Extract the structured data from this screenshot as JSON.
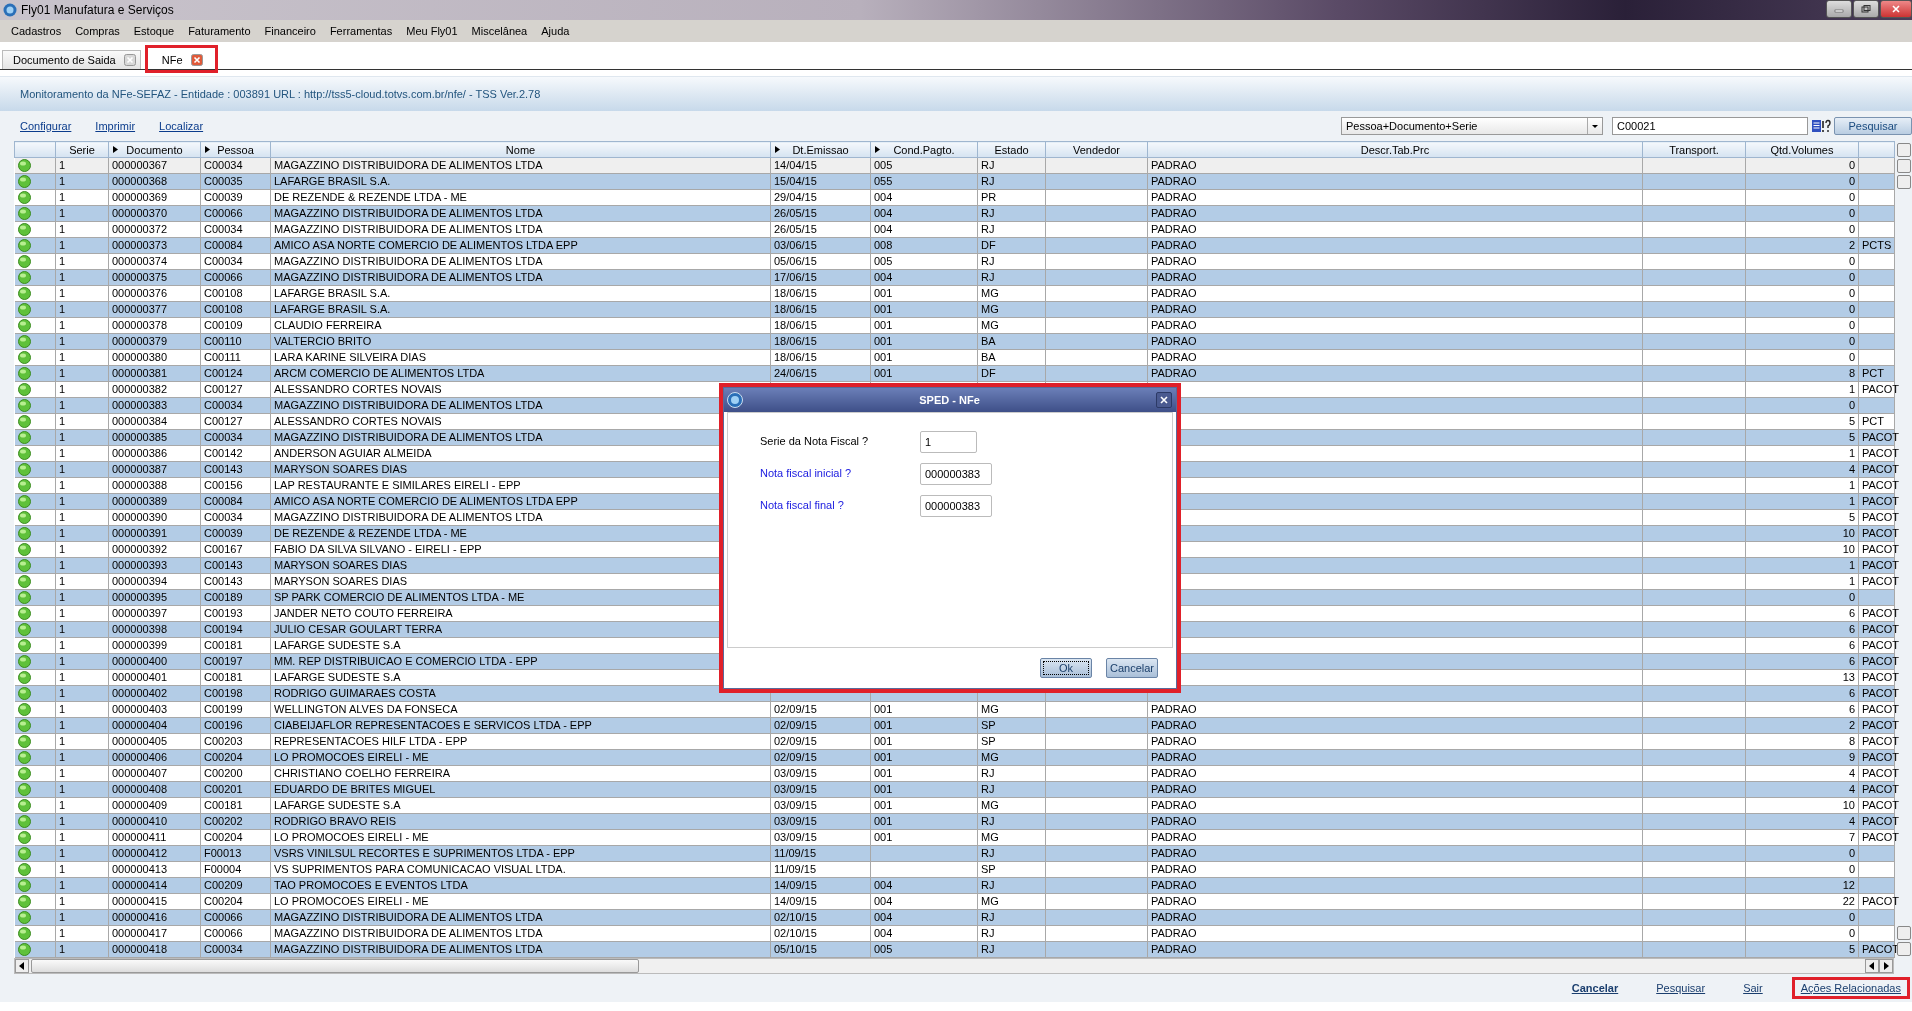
{
  "window": {
    "title": "Fly01 Manufatura e Serviços"
  },
  "menu": [
    "Cadastros",
    "Compras",
    "Estoque",
    "Faturamento",
    "Financeiro",
    "Ferramentas",
    "Meu Fly01",
    "Miscelânea",
    "Ajuda"
  ],
  "tabs": [
    {
      "label": "Documento de Saida",
      "selected": false,
      "highlighted": false
    },
    {
      "label": "NFe",
      "selected": true,
      "highlighted": true
    }
  ],
  "header": {
    "text": "Monitoramento da NFe-SEFAZ - Entidade : 003891 URL : http://tss5-cloud.totvs.com.br/nfe/ - TSS Ver.2.78"
  },
  "links": [
    "Configurar",
    "Imprimir",
    "Localizar"
  ],
  "search": {
    "index": "Pessoa+Documento+Serie",
    "value": "C00021",
    "button": "Pesquisar"
  },
  "table": {
    "columns": [
      {
        "label": "Serie",
        "sortable": false
      },
      {
        "label": "Documento",
        "sortable": true
      },
      {
        "label": "Pessoa",
        "sortable": true
      },
      {
        "label": "Nome",
        "sortable": false
      },
      {
        "label": "Dt.Emissao",
        "sortable": true
      },
      {
        "label": "Cond.Pagto.",
        "sortable": true
      },
      {
        "label": "Estado",
        "sortable": false
      },
      {
        "label": "Vendedor",
        "sortable": false
      },
      {
        "label": "Descr.Tab.Prc",
        "sortable": false
      },
      {
        "label": "Transport.",
        "sortable": false
      },
      {
        "label": "Qtd.Volumes",
        "sortable": false
      }
    ],
    "rows": [
      {
        "selected": true,
        "serie": "1",
        "documento": "000000367",
        "pessoa": "C00034",
        "nome": "MAGAZZINO DISTRIBUIDORA DE ALIMENTOS LTDA",
        "dt_emissao": "14/04/15",
        "cond_pagto": "005",
        "estado": "RJ",
        "descr_tab_prc": "PADRAO",
        "qtd_volumes": "0"
      },
      {
        "selected": false,
        "serie": "1",
        "documento": "000000368",
        "pessoa": "C00035",
        "nome": "LAFARGE BRASIL S.A.",
        "dt_emissao": "15/04/15",
        "cond_pagto": "055",
        "estado": "RJ",
        "descr_tab_prc": "PADRAO",
        "qtd_volumes": "0"
      },
      {
        "selected": false,
        "serie": "1",
        "documento": "000000369",
        "pessoa": "C00039",
        "nome": "DE REZENDE & REZENDE LTDA - ME",
        "dt_emissao": "29/04/15",
        "cond_pagto": "004",
        "estado": "PR",
        "descr_tab_prc": "PADRAO",
        "qtd_volumes": "0"
      },
      {
        "selected": false,
        "serie": "1",
        "documento": "000000370",
        "pessoa": "C00066",
        "nome": "MAGAZZINO DISTRIBUIDORA DE ALIMENTOS LTDA",
        "dt_emissao": "26/05/15",
        "cond_pagto": "004",
        "estado": "RJ",
        "descr_tab_prc": "PADRAO",
        "qtd_volumes": "0"
      },
      {
        "selected": false,
        "serie": "1",
        "documento": "000000372",
        "pessoa": "C00034",
        "nome": "MAGAZZINO DISTRIBUIDORA DE ALIMENTOS LTDA",
        "dt_emissao": "26/05/15",
        "cond_pagto": "004",
        "estado": "RJ",
        "descr_tab_prc": "PADRAO",
        "qtd_volumes": "0"
      },
      {
        "selected": false,
        "serie": "1",
        "documento": "000000373",
        "pessoa": "C00084",
        "nome": "AMICO ASA NORTE COMERCIO DE ALIMENTOS LTDA EPP",
        "dt_emissao": "03/06/15",
        "cond_pagto": "008",
        "estado": "DF",
        "descr_tab_prc": "PADRAO",
        "qtd_volumes": "2",
        "column_13": "PCTS"
      },
      {
        "selected": false,
        "serie": "1",
        "documento": "000000374",
        "pessoa": "C00034",
        "nome": "MAGAZZINO DISTRIBUIDORA DE ALIMENTOS LTDA",
        "dt_emissao": "05/06/15",
        "cond_pagto": "005",
        "estado": "RJ",
        "descr_tab_prc": "PADRAO",
        "qtd_volumes": "0"
      },
      {
        "selected": false,
        "serie": "1",
        "documento": "000000375",
        "pessoa": "C00066",
        "nome": "MAGAZZINO DISTRIBUIDORA DE ALIMENTOS LTDA",
        "dt_emissao": "17/06/15",
        "cond_pagto": "004",
        "estado": "RJ",
        "descr_tab_prc": "PADRAO",
        "qtd_volumes": "0"
      },
      {
        "selected": false,
        "serie": "1",
        "documento": "000000376",
        "pessoa": "C00108",
        "nome": "LAFARGE BRASIL S.A.",
        "dt_emissao": "18/06/15",
        "cond_pagto": "001",
        "estado": "MG",
        "descr_tab_prc": "PADRAO",
        "qtd_volumes": "0"
      },
      {
        "selected": false,
        "serie": "1",
        "documento": "000000377",
        "pessoa": "C00108",
        "nome": "LAFARGE BRASIL S.A.",
        "dt_emissao": "18/06/15",
        "cond_pagto": "001",
        "estado": "MG",
        "descr_tab_prc": "PADRAO",
        "qtd_volumes": "0"
      },
      {
        "selected": false,
        "serie": "1",
        "documento": "000000378",
        "pessoa": "C00109",
        "nome": "CLAUDIO FERREIRA",
        "dt_emissao": "18/06/15",
        "cond_pagto": "001",
        "estado": "MG",
        "descr_tab_prc": "PADRAO",
        "qtd_volumes": "0"
      },
      {
        "selected": false,
        "serie": "1",
        "documento": "000000379",
        "pessoa": "C00110",
        "nome": "VALTERCIO BRITO",
        "dt_emissao": "18/06/15",
        "cond_pagto": "001",
        "estado": "BA",
        "descr_tab_prc": "PADRAO",
        "qtd_volumes": "0"
      },
      {
        "selected": false,
        "serie": "1",
        "documento": "000000380",
        "pessoa": "C00111",
        "nome": "LARA KARINE SILVEIRA DIAS",
        "dt_emissao": "18/06/15",
        "cond_pagto": "001",
        "estado": "BA",
        "descr_tab_prc": "PADRAO",
        "qtd_volumes": "0"
      },
      {
        "selected": false,
        "serie": "1",
        "documento": "000000381",
        "pessoa": "C00124",
        "nome": "ARCM COMERCIO DE ALIMENTOS LTDA",
        "dt_emissao": "24/06/15",
        "cond_pagto": "001",
        "estado": "DF",
        "descr_tab_prc": "PADRAO",
        "qtd_volumes": "8",
        "column_13": "PCT"
      },
      {
        "selected": false,
        "serie": "1",
        "documento": "000000382",
        "pessoa": "C00127",
        "nome": "ALESSANDRO CORTES NOVAIS",
        "qtd_volumes": "1",
        "column_13": "PACOT"
      },
      {
        "selected": false,
        "serie": "1",
        "documento": "000000383",
        "pessoa": "C00034",
        "nome": "MAGAZZINO DISTRIBUIDORA DE ALIMENTOS LTDA",
        "qtd_volumes": "0"
      },
      {
        "selected": false,
        "serie": "1",
        "documento": "000000384",
        "pessoa": "C00127",
        "nome": "ALESSANDRO CORTES NOVAIS",
        "qtd_volumes": "5",
        "column_13": "PCT"
      },
      {
        "selected": false,
        "serie": "1",
        "documento": "000000385",
        "pessoa": "C00034",
        "nome": "MAGAZZINO DISTRIBUIDORA DE ALIMENTOS LTDA",
        "qtd_volumes": "5",
        "column_13": "PACOT"
      },
      {
        "selected": false,
        "serie": "1",
        "documento": "000000386",
        "pessoa": "C00142",
        "nome": "ANDERSON AGUIAR ALMEIDA",
        "qtd_volumes": "1",
        "column_13": "PACOT"
      },
      {
        "selected": false,
        "serie": "1",
        "documento": "000000387",
        "pessoa": "C00143",
        "nome": "MARYSON SOARES DIAS",
        "qtd_volumes": "4",
        "column_13": "PACOT"
      },
      {
        "selected": false,
        "serie": "1",
        "documento": "000000388",
        "pessoa": "C00156",
        "nome": "LAP RESTAURANTE E SIMILARES EIRELI - EPP",
        "qtd_volumes": "1",
        "column_13": "PACOT"
      },
      {
        "selected": false,
        "serie": "1",
        "documento": "000000389",
        "pessoa": "C00084",
        "nome": "AMICO ASA NORTE COMERCIO DE ALIMENTOS LTDA EPP",
        "qtd_volumes": "1",
        "column_13": "PACOT"
      },
      {
        "selected": false,
        "serie": "1",
        "documento": "000000390",
        "pessoa": "C00034",
        "nome": "MAGAZZINO DISTRIBUIDORA DE ALIMENTOS LTDA",
        "qtd_volumes": "5",
        "column_13": "PACOT"
      },
      {
        "selected": false,
        "serie": "1",
        "documento": "000000391",
        "pessoa": "C00039",
        "nome": "DE REZENDE & REZENDE LTDA - ME",
        "qtd_volumes": "10",
        "column_13": "PACOT"
      },
      {
        "selected": false,
        "serie": "1",
        "documento": "000000392",
        "pessoa": "C00167",
        "nome": "FABIO DA SILVA SILVANO - EIRELI - EPP",
        "qtd_volumes": "10",
        "column_13": "PACOT"
      },
      {
        "selected": false,
        "serie": "1",
        "documento": "000000393",
        "pessoa": "C00143",
        "nome": "MARYSON SOARES DIAS",
        "qtd_volumes": "1",
        "column_13": "PACOT"
      },
      {
        "selected": false,
        "serie": "1",
        "documento": "000000394",
        "pessoa": "C00143",
        "nome": "MARYSON SOARES DIAS",
        "qtd_volumes": "1",
        "column_13": "PACOT"
      },
      {
        "selected": false,
        "serie": "1",
        "documento": "000000395",
        "pessoa": "C00189",
        "nome": "SP PARK COMERCIO DE ALIMENTOS LTDA - ME",
        "qtd_volumes": "0"
      },
      {
        "selected": false,
        "serie": "1",
        "documento": "000000397",
        "pessoa": "C00193",
        "nome": "JANDER NETO COUTO FERREIRA",
        "qtd_volumes": "6",
        "column_13": "PACOT"
      },
      {
        "selected": false,
        "serie": "1",
        "documento": "000000398",
        "pessoa": "C00194",
        "nome": "JULIO CESAR GOULART TERRA",
        "qtd_volumes": "6",
        "column_13": "PACOT"
      },
      {
        "selected": false,
        "serie": "1",
        "documento": "000000399",
        "pessoa": "C00181",
        "nome": "LAFARGE SUDESTE S.A",
        "qtd_volumes": "6",
        "column_13": "PACOT"
      },
      {
        "selected": false,
        "serie": "1",
        "documento": "000000400",
        "pessoa": "C00197",
        "nome": "MM. REP DISTRIBUICAO E COMERCIO LTDA - EPP",
        "qtd_volumes": "6",
        "column_13": "PACOT"
      },
      {
        "selected": false,
        "serie": "1",
        "documento": "000000401",
        "pessoa": "C00181",
        "nome": "LAFARGE SUDESTE S.A",
        "qtd_volumes": "13",
        "column_13": "PACOT"
      },
      {
        "selected": false,
        "serie": "1",
        "documento": "000000402",
        "pessoa": "C00198",
        "nome": "RODRIGO GUIMARAES COSTA",
        "qtd_volumes": "6",
        "column_13": "PACOT"
      },
      {
        "selected": false,
        "serie": "1",
        "documento": "000000403",
        "pessoa": "C00199",
        "nome": "WELLINGTON ALVES DA FONSECA",
        "dt_emissao": "02/09/15",
        "cond_pagto": "001",
        "estado": "MG",
        "descr_tab_prc": "PADRAO",
        "qtd_volumes": "6",
        "column_13": "PACOT"
      },
      {
        "selected": false,
        "serie": "1",
        "documento": "000000404",
        "pessoa": "C00196",
        "nome": "CIABEIJAFLOR REPRESENTACOES E SERVICOS LTDA - EPP",
        "dt_emissao": "02/09/15",
        "cond_pagto": "001",
        "estado": "SP",
        "descr_tab_prc": "PADRAO",
        "qtd_volumes": "2",
        "column_13": "PACOT"
      },
      {
        "selected": false,
        "serie": "1",
        "documento": "000000405",
        "pessoa": "C00203",
        "nome": "REPRESENTACOES HILF LTDA - EPP",
        "dt_emissao": "02/09/15",
        "cond_pagto": "001",
        "estado": "SP",
        "descr_tab_prc": "PADRAO",
        "qtd_volumes": "8",
        "column_13": "PACOT"
      },
      {
        "selected": false,
        "serie": "1",
        "documento": "000000406",
        "pessoa": "C00204",
        "nome": "LO PROMOCOES EIRELI - ME",
        "dt_emissao": "02/09/15",
        "cond_pagto": "001",
        "estado": "MG",
        "descr_tab_prc": "PADRAO",
        "qtd_volumes": "9",
        "column_13": "PACOT"
      },
      {
        "selected": false,
        "serie": "1",
        "documento": "000000407",
        "pessoa": "C00200",
        "nome": "CHRISTIANO COELHO FERREIRA",
        "dt_emissao": "03/09/15",
        "cond_pagto": "001",
        "estado": "RJ",
        "descr_tab_prc": "PADRAO",
        "qtd_volumes": "4",
        "column_13": "PACOT"
      },
      {
        "selected": false,
        "serie": "1",
        "documento": "000000408",
        "pessoa": "C00201",
        "nome": "EDUARDO DE BRITES MIGUEL",
        "dt_emissao": "03/09/15",
        "cond_pagto": "001",
        "estado": "RJ",
        "descr_tab_prc": "PADRAO",
        "qtd_volumes": "4",
        "column_13": "PACOT"
      },
      {
        "selected": false,
        "serie": "1",
        "documento": "000000409",
        "pessoa": "C00181",
        "nome": "LAFARGE SUDESTE S.A",
        "dt_emissao": "03/09/15",
        "cond_pagto": "001",
        "estado": "MG",
        "descr_tab_prc": "PADRAO",
        "qtd_volumes": "10",
        "column_13": "PACOT"
      },
      {
        "selected": false,
        "serie": "1",
        "documento": "000000410",
        "pessoa": "C00202",
        "nome": "RODRIGO BRAVO REIS",
        "dt_emissao": "03/09/15",
        "cond_pagto": "001",
        "estado": "RJ",
        "descr_tab_prc": "PADRAO",
        "qtd_volumes": "4",
        "column_13": "PACOT"
      },
      {
        "selected": false,
        "serie": "1",
        "documento": "000000411",
        "pessoa": "C00204",
        "nome": "LO PROMOCOES EIRELI - ME",
        "dt_emissao": "03/09/15",
        "cond_pagto": "001",
        "estado": "MG",
        "descr_tab_prc": "PADRAO",
        "qtd_volumes": "7",
        "column_13": "PACOT"
      },
      {
        "selected": false,
        "serie": "1",
        "documento": "000000412",
        "pessoa": "F00013",
        "nome": "VSRS VINILSUL RECORTES E SUPRIMENTOS LTDA - EPP",
        "dt_emissao": "11/09/15",
        "estado": "RJ",
        "descr_tab_prc": "PADRAO",
        "qtd_volumes": "0"
      },
      {
        "selected": false,
        "serie": "1",
        "documento": "000000413",
        "pessoa": "F00004",
        "nome": "VS SUPRIMENTOS PARA COMUNICACAO VISUAL LTDA.",
        "dt_emissao": "11/09/15",
        "estado": "SP",
        "descr_tab_prc": "PADRAO",
        "qtd_volumes": "0"
      },
      {
        "selected": false,
        "serie": "1",
        "documento": "000000414",
        "pessoa": "C00209",
        "nome": "TAO PROMOCOES E EVENTOS LTDA",
        "dt_emissao": "14/09/15",
        "cond_pagto": "004",
        "estado": "RJ",
        "descr_tab_prc": "PADRAO",
        "qtd_volumes": "12"
      },
      {
        "selected": false,
        "serie": "1",
        "documento": "000000415",
        "pessoa": "C00204",
        "nome": "LO PROMOCOES EIRELI - ME",
        "dt_emissao": "14/09/15",
        "cond_pagto": "004",
        "estado": "MG",
        "descr_tab_prc": "PADRAO",
        "qtd_volumes": "22",
        "column_13": "PACOT"
      },
      {
        "selected": false,
        "serie": "1",
        "documento": "000000416",
        "pessoa": "C00066",
        "nome": "MAGAZZINO DISTRIBUIDORA DE ALIMENTOS LTDA",
        "dt_emissao": "02/10/15",
        "cond_pagto": "004",
        "estado": "RJ",
        "descr_tab_prc": "PADRAO",
        "qtd_volumes": "0"
      },
      {
        "selected": false,
        "serie": "1",
        "documento": "000000417",
        "pessoa": "C00066",
        "nome": "MAGAZZINO DISTRIBUIDORA DE ALIMENTOS LTDA",
        "dt_emissao": "02/10/15",
        "cond_pagto": "004",
        "estado": "RJ",
        "descr_tab_prc": "PADRAO",
        "qtd_volumes": "0"
      },
      {
        "selected": false,
        "serie": "1",
        "documento": "000000418",
        "pessoa": "C00034",
        "nome": "MAGAZZINO DISTRIBUIDORA DE ALIMENTOS LTDA",
        "dt_emissao": "05/10/15",
        "cond_pagto": "005",
        "estado": "RJ",
        "descr_tab_prc": "PADRAO",
        "qtd_volumes": "5",
        "column_13": "PACOT"
      }
    ]
  },
  "dialog": {
    "title": "SPED - NFe",
    "fields": [
      {
        "label": "Serie da Nota Fiscal ?",
        "kind": "plain",
        "value": "1"
      },
      {
        "label": "Nota fiscal inicial ?",
        "kind": "range",
        "value": "000000383"
      },
      {
        "label": "Nota fiscal final ?",
        "kind": "range",
        "value": "000000383"
      }
    ],
    "buttons": [
      {
        "label": "Ok",
        "focused": true
      },
      {
        "label": "Cancelar",
        "focused": false
      }
    ]
  },
  "footer": [
    {
      "label": "Cancelar",
      "kind": "primary",
      "highlighted": false
    },
    {
      "label": "Pesquisar",
      "kind": "plain",
      "highlighted": false
    },
    {
      "label": "Sair",
      "kind": "plain",
      "highlighted": false
    },
    {
      "label": "Ações Relacionadas",
      "kind": "plain",
      "highlighted": true
    }
  ]
}
